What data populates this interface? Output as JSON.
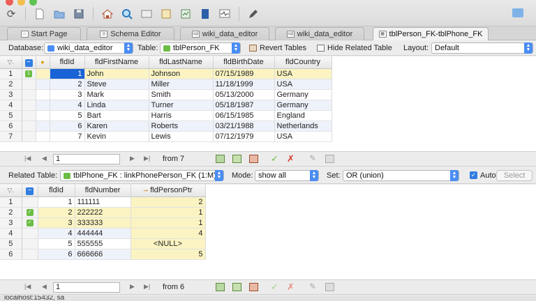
{
  "tabs": [
    {
      "label": "Start Page",
      "icon": "home-icon"
    },
    {
      "label": "Schema Editor",
      "icon": "schema-icon"
    },
    {
      "label": "wiki_data_editor",
      "icon": "sql-icon"
    },
    {
      "label": "wiki_data_editor",
      "icon": "sql-icon"
    },
    {
      "label": "tblPerson_FK-tblPhone_FK",
      "icon": "table-icon"
    }
  ],
  "options": {
    "database_label": "Database:",
    "database_value": "wiki_data_editor",
    "table_label": "Table:",
    "table_value": "tblPerson_FK",
    "revert_label": "Revert Tables",
    "hide_related_label": "Hide Related Table",
    "layout_label": "Layout:",
    "layout_value": "Default"
  },
  "person_grid": {
    "columns": [
      "fldId",
      "fldFirstName",
      "fldLastName",
      "fldBirthDate",
      "fldCountry"
    ],
    "rows": [
      {
        "rn": "1",
        "id": "1",
        "first": "John",
        "last": "Johnson",
        "birth": "07/15/1989",
        "country": "USA"
      },
      {
        "rn": "2",
        "id": "2",
        "first": "Steve",
        "last": "Miller",
        "birth": "11/18/1999",
        "country": "USA"
      },
      {
        "rn": "3",
        "id": "3",
        "first": "Mark",
        "last": "Smith",
        "birth": "05/13/2000",
        "country": "Germany"
      },
      {
        "rn": "4",
        "id": "4",
        "first": "Linda",
        "last": "Turner",
        "birth": "05/18/1987",
        "country": "Germany"
      },
      {
        "rn": "5",
        "id": "5",
        "first": "Bart",
        "last": "Harris",
        "birth": "06/15/1985",
        "country": "England"
      },
      {
        "rn": "6",
        "id": "6",
        "first": "Karen",
        "last": "Roberts",
        "birth": "03/21/1988",
        "country": "Netherlands"
      },
      {
        "rn": "7",
        "id": "7",
        "first": "Kevin",
        "last": "Lewis",
        "birth": "07/12/1979",
        "country": "USA"
      }
    ]
  },
  "person_nav": {
    "page": "1",
    "from_text": "from 7"
  },
  "related": {
    "label": "Related Table:",
    "value": "tblPhone_FK : linkPhonePerson_FK (1:M)",
    "mode_label": "Mode:",
    "mode_value": "show all",
    "set_label": "Set:",
    "set_value": "OR (union)",
    "auto_label": "Auto",
    "select_label": "Select"
  },
  "phone_grid": {
    "columns": [
      "fldId",
      "fldNumber",
      "fldPersonPtr"
    ],
    "rows": [
      {
        "rn": "1",
        "id": "1",
        "number": "111111",
        "ptr": "2",
        "checked": false
      },
      {
        "rn": "2",
        "id": "2",
        "number": "222222",
        "ptr": "1",
        "checked": true
      },
      {
        "rn": "3",
        "id": "3",
        "number": "333333",
        "ptr": "1",
        "checked": true
      },
      {
        "rn": "4",
        "id": "4",
        "number": "444444",
        "ptr": "4",
        "checked": false
      },
      {
        "rn": "5",
        "id": "5",
        "number": "555555",
        "ptr": "<NULL>",
        "checked": false
      },
      {
        "rn": "6",
        "id": "6",
        "number": "666666",
        "ptr": "5",
        "checked": false
      }
    ]
  },
  "phone_nav": {
    "page": "1",
    "from_text": "from 6"
  },
  "status": {
    "text": "localhost:15432, sa"
  },
  "colors": {
    "accent": "#2f7de1",
    "selection": "#1a63d6",
    "highlight": "#fbf4c2",
    "mark": "#6cbd45"
  }
}
